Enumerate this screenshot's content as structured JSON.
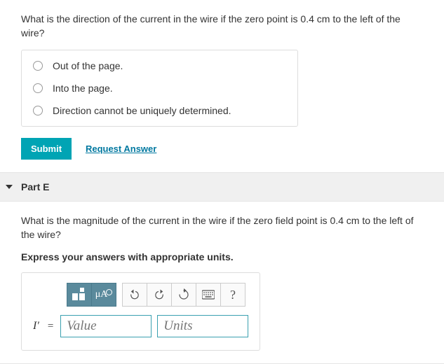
{
  "partD": {
    "question": "What is the direction of the current in the wire if the zero point is 0.4 cm to the left of the wire?",
    "options": [
      "Out of the page.",
      "Into the page.",
      "Direction cannot be uniquely determined."
    ],
    "submit": "Submit",
    "request": "Request Answer"
  },
  "partE": {
    "title": "Part E",
    "question": "What is the magnitude of the current in the wire if the zero field point is 0.4 cm to the left of the wire?",
    "instruction": "Express your answers with appropriate units.",
    "toolbar": {
      "format": "format",
      "units_symbol": "μÅ",
      "help": "?"
    },
    "variable": "I′",
    "equals": "=",
    "value_placeholder": "Value",
    "units_placeholder": "Units"
  }
}
